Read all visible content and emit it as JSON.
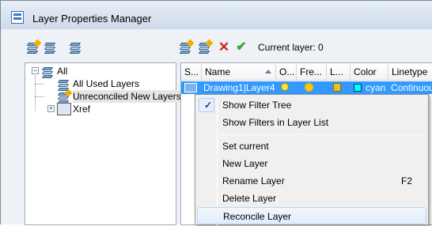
{
  "window": {
    "title": "Layer Properties Manager"
  },
  "toolbar": {
    "current_layer_label": "Current layer: 0"
  },
  "filter_tree": {
    "root": "All",
    "children": [
      "All Used Layers",
      "Unreconciled New Layers",
      "Xref"
    ]
  },
  "layer_table": {
    "columns": [
      "S...",
      "Name",
      "O...",
      "Fre...",
      "L...",
      "Color",
      "Linetype"
    ],
    "rows": [
      {
        "name": "Drawing1|Layer4",
        "color": "cyan",
        "color_hex": "#00ffff",
        "linetype": "Continuous"
      }
    ]
  },
  "context_menu": {
    "items": [
      {
        "label": "Show Filter Tree",
        "checked": true,
        "shortcut": ""
      },
      {
        "label": "Show Filters in Layer List",
        "checked": false,
        "shortcut": ""
      },
      {
        "label": "Set current",
        "checked": false,
        "shortcut": ""
      },
      {
        "label": "New Layer",
        "checked": false,
        "shortcut": ""
      },
      {
        "label": "Rename Layer",
        "checked": false,
        "shortcut": "F2"
      },
      {
        "label": "Delete Layer",
        "checked": false,
        "shortcut": ""
      },
      {
        "label": "Reconcile Layer",
        "checked": false,
        "shortcut": ""
      }
    ]
  },
  "colors": {
    "selection": "#3399ff",
    "menu_bg": "#f0f0f0",
    "window_bg": "#eef1f6"
  },
  "icons": {
    "check_glyph": "✓",
    "delete_glyph": "✕",
    "apply_glyph": "✔"
  }
}
